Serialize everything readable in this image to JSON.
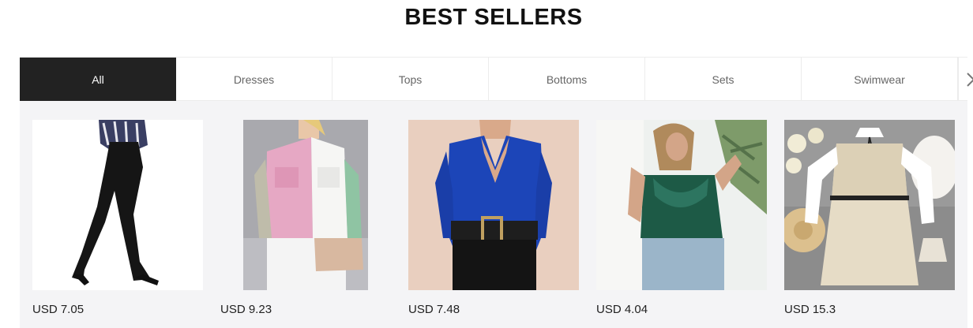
{
  "section_title": "BEST SELLERS",
  "tabs": [
    {
      "label": "All",
      "active": true
    },
    {
      "label": "Dresses",
      "active": false
    },
    {
      "label": "Tops",
      "active": false
    },
    {
      "label": "Bottoms",
      "active": false
    },
    {
      "label": "Sets",
      "active": false
    },
    {
      "label": "Swimwear",
      "active": false
    }
  ],
  "tab_next_icon": "chevron-right-icon",
  "products": [
    {
      "price": "USD 7.05",
      "image": "black-flared-pants-photo"
    },
    {
      "price": "USD 9.23",
      "image": "pink-colorblock-shirt-photo"
    },
    {
      "price": "USD 7.48",
      "image": "blue-wrap-bodysuit-photo"
    },
    {
      "price": "USD 4.04",
      "image": "green-satin-cami-photo"
    },
    {
      "price": "USD 15.3",
      "image": "tweed-shirt-dress-photo"
    }
  ],
  "colors": {
    "active_tab": "#222222",
    "grid_bg": "#f4f4f6"
  }
}
